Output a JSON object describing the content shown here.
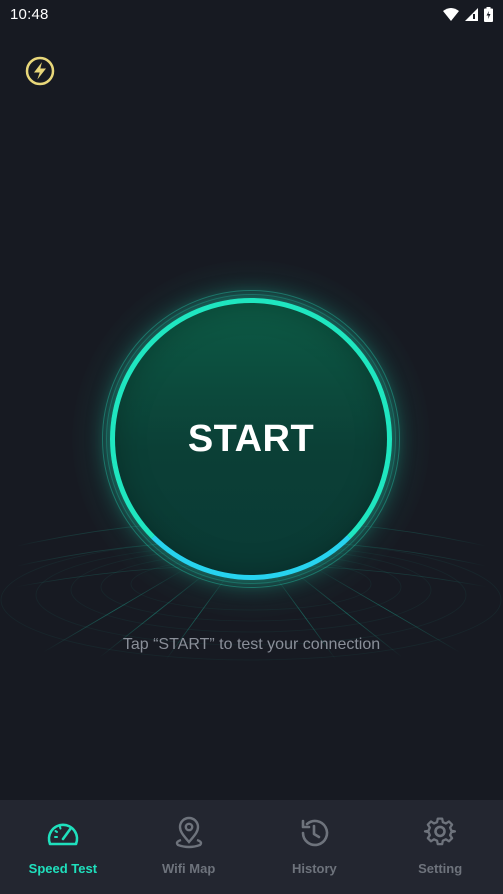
{
  "status_bar": {
    "time": "10:48",
    "icons": [
      "wifi-icon",
      "signal-icon",
      "battery-icon"
    ]
  },
  "header": {
    "logo_icon": "lightning-bolt-icon"
  },
  "main": {
    "start_label": "START",
    "hint": "Tap “START” to test your connection"
  },
  "bottom_nav": {
    "items": [
      {
        "label": "Speed Test",
        "icon": "speedometer-icon",
        "active": true
      },
      {
        "label": "Wifi Map",
        "icon": "map-pin-icon",
        "active": false
      },
      {
        "label": "History",
        "icon": "history-icon",
        "active": false
      },
      {
        "label": "Setting",
        "icon": "gear-icon",
        "active": false
      }
    ]
  },
  "colors": {
    "background": "#171a22",
    "accent": "#1fe0bd",
    "nav_background": "#232630",
    "inactive": "#6e737c"
  }
}
